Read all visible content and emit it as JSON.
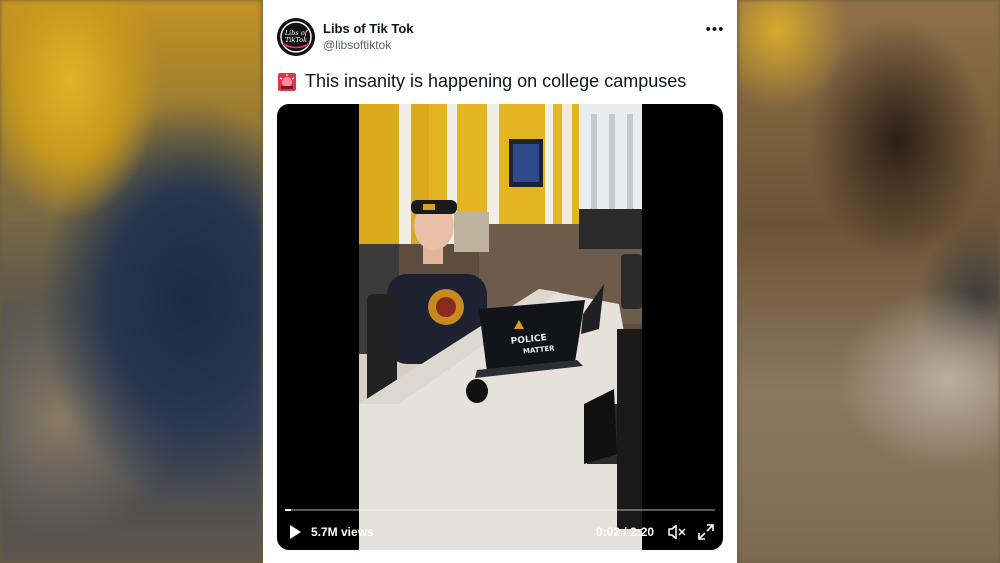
{
  "tweet": {
    "display_name": "Libs of Tik Tok",
    "handle": "@libsoftiktok",
    "more_icon": "more-dots-icon",
    "text": "This insanity is happening on college campuses",
    "emoji_icon": "police-siren-icon",
    "avatar_text": [
      "Libs of",
      "TikTok"
    ]
  },
  "video": {
    "views": "5.7M views",
    "time": "0:02 / 2:20",
    "progress_fraction": 0.014,
    "laptop_sticker": [
      "POLICE",
      "MATTER"
    ],
    "icons": [
      "play-icon",
      "volume-mute-icon",
      "fullscreen-icon"
    ]
  },
  "colors": {
    "card": "#ffffff",
    "text": "#0f1419",
    "secondary": "#536471",
    "video_bg": "#000000"
  }
}
